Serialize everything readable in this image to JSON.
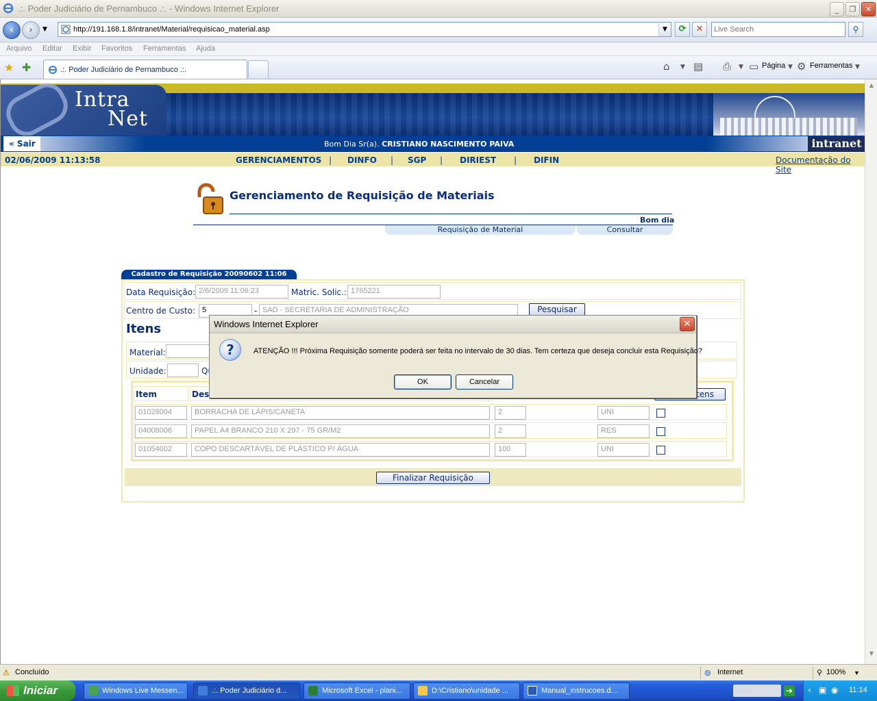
{
  "window": {
    "title": ".:. Poder Judiciário de Pernambuco .:. - Windows Internet Explorer",
    "address": "http://191.168.1.8/intranet/Material/requisicao_material.asp",
    "search_placeholder": "Live Search",
    "menu": [
      "Arquivo",
      "Editar",
      "Exibir",
      "Favoritos",
      "Ferramentas",
      "Ajuda"
    ],
    "tab_label": ".:. Poder Judiciário de Pernambuco .:.",
    "cmd_pagina": "Página",
    "cmd_ferramentas": "Ferramentas"
  },
  "site": {
    "logo_line1": "Intra",
    "logo_line2": "Net",
    "sair": "« Sair",
    "greeting_prefix": "Bom Dia Sr(a).",
    "user_name": "CRISTIANO NASCIMENTO PAIVA",
    "badge": "intranet",
    "datetime": "02/06/2009 11:13:58",
    "nav": [
      "GERENCIAMENTOS",
      "DINFO",
      "SGP",
      "DIRIEST",
      "DIFIN"
    ],
    "doc_link": "Documentação do Site"
  },
  "page": {
    "title": "Gerenciamento de Requisição de Materiais",
    "bom_dia": "Bom dia",
    "subtabs": [
      "Requisição de Material",
      "Consultar"
    ]
  },
  "form": {
    "tab_title": "Cadastro de Requisição 20090602 11:06",
    "data_label": "Data Requisição:",
    "data_value": "2/6/2009 11:06:23",
    "matric_label": "Matric. Solic.:",
    "matric_value": "1765221",
    "centro_label": "Centro de Custo:",
    "centro_value": "5",
    "centro_desc": "SAD - SECRETARIA DE ADMINISTRAÇÃO",
    "pesquisar": "Pesquisar",
    "itens_title": "Itens",
    "material_label": "Material:",
    "unidade_label": "Unidade:",
    "qtd_label_fragment": "Qu",
    "col_item": "Item",
    "col_desc_fragment": "Desc",
    "remove_fragment": "Itens",
    "rows": [
      {
        "code": "01028004",
        "desc": "BORRACHA DE LÁPIS/CANETA",
        "qty": "2",
        "unit": "UNI"
      },
      {
        "code": "04008006",
        "desc": "PAPEL A4 BRANCO 210 X 297 - 75 GR/M2",
        "qty": "2",
        "unit": "RES"
      },
      {
        "code": "01054002",
        "desc": "COPO DESCARTÁVEL DE PLÁSTICO P/ ÁGUA",
        "qty": "100",
        "unit": "UNI"
      }
    ],
    "finalizar": "Finalizar Requisição"
  },
  "dialog": {
    "title": "Windows Internet Explorer",
    "message": "ATENÇÃO !!! Próxima Requisição somente poderá ser feita no intervalo de 30 dias. Tem certeza que deseja concluir esta Requisição?",
    "ok": "OK",
    "cancel": "Cancelar"
  },
  "status": {
    "text": "Concluído",
    "zone": "Internet",
    "zoom": "100%"
  },
  "taskbar": {
    "start": "Iniciar",
    "tasks": [
      "Windows Live Messen...",
      ".:. Poder Judiciário d...",
      "Microsoft Excel - plani...",
      "D:\\Cristiano\\unidade ...",
      "Manual_instrucoes.d..."
    ],
    "clock": "11:14"
  }
}
